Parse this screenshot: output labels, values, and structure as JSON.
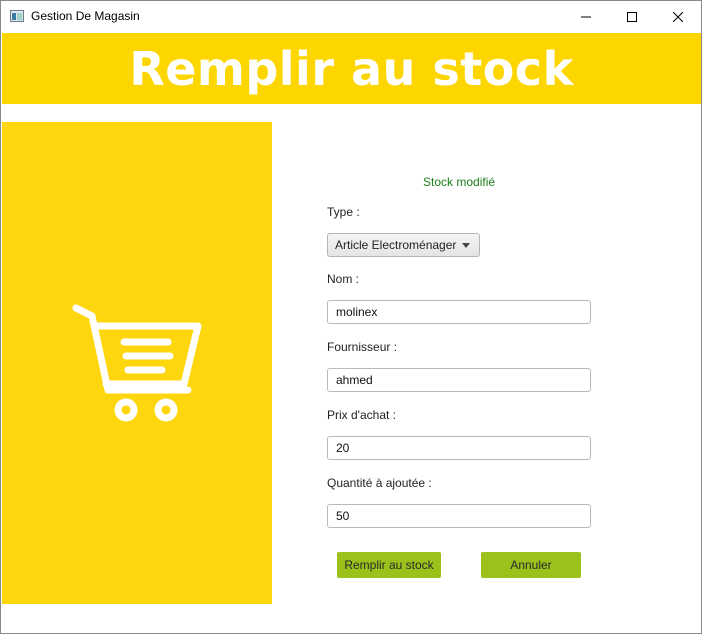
{
  "window": {
    "title": "Gestion De Magasin",
    "controls": {
      "minimize_icon": "minimize-icon",
      "maximize_icon": "maximize-icon",
      "close_icon": "close-icon"
    }
  },
  "header": {
    "title": "Remplir au stock",
    "background": "#fdd600",
    "text_color": "#ffffff"
  },
  "side_panel": {
    "background": "#fdd60d",
    "icon": "shopping-cart-icon"
  },
  "form": {
    "status": "Stock modifié",
    "status_color": "#1a7f1a",
    "type": {
      "label": "Type :",
      "selected": "Article Electroménager"
    },
    "nom": {
      "label": "Nom :",
      "value": "molinex"
    },
    "fournisseur": {
      "label": "Fournisseur :",
      "value": "ahmed"
    },
    "prix": {
      "label": "Prix d'achat :",
      "value": "20"
    },
    "quantite": {
      "label": "Quantité à ajoutée :",
      "value": "50"
    }
  },
  "actions": {
    "submit_label": "Remplir au stock",
    "cancel_label": "Annuler",
    "button_color": "#9bc21b"
  }
}
